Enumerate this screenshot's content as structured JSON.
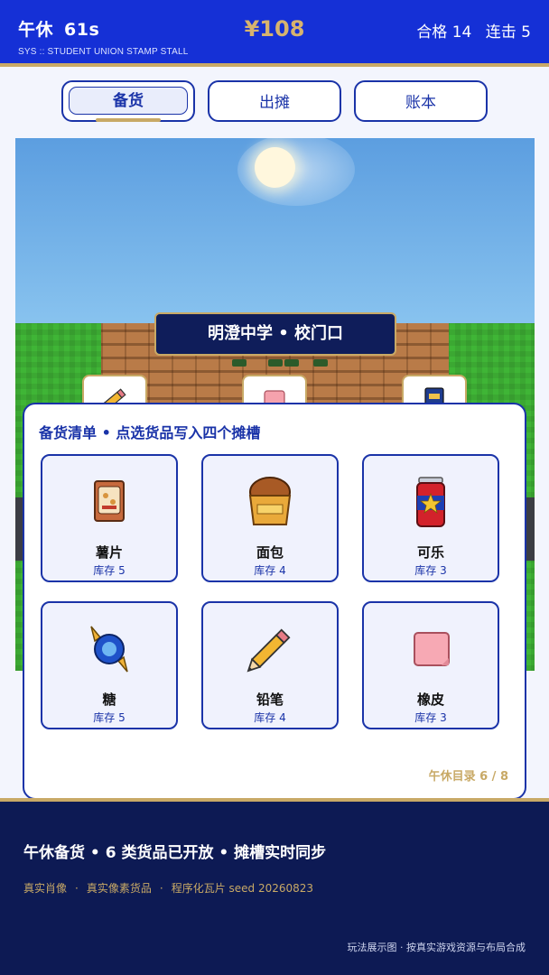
{
  "header": {
    "period": "午休",
    "timer": "61s",
    "subtitle": "SYS :: STUDENT UNION STAMP STALL",
    "money": "¥108",
    "pass_label": "合格 14",
    "combo_label": "连击 5"
  },
  "tabs": [
    {
      "label": "备货",
      "active": true
    },
    {
      "label": "出摊",
      "active": false
    },
    {
      "label": "账本",
      "active": false
    }
  ],
  "scene": {
    "location_sign": "明澄中学 • 校门口",
    "slots": [
      "pencil-icon",
      "eraser-icon",
      "notebook-icon"
    ]
  },
  "panel": {
    "title": "备货清单 • 点选货品写入四个摊槽",
    "items": [
      {
        "name": "薯片",
        "stock": "库存 5",
        "icon": "chips-icon"
      },
      {
        "name": "面包",
        "stock": "库存 4",
        "icon": "bread-icon"
      },
      {
        "name": "可乐",
        "stock": "库存 3",
        "icon": "cola-can-icon"
      },
      {
        "name": "糖",
        "stock": "库存 5",
        "icon": "candy-icon"
      },
      {
        "name": "铅笔",
        "stock": "库存 4",
        "icon": "pencil-icon"
      },
      {
        "name": "橡皮",
        "stock": "库存 3",
        "icon": "eraser-icon"
      }
    ],
    "catalog": "午休目录 6 / 8"
  },
  "footer": {
    "title": "午休备货 • 6 类货品已开放 • 摊槽实时同步",
    "credits": [
      "真实肖像",
      "真实像素货品",
      "程序化瓦片 seed 20260823"
    ],
    "note": "玩法展示图 · 按真实游戏资源与布局合成"
  },
  "colors": {
    "primary_blue": "#1530d6",
    "navy": "#0d1a54",
    "gold": "#c8a966",
    "grass": "#3fb536",
    "brick": "#b97b48"
  }
}
